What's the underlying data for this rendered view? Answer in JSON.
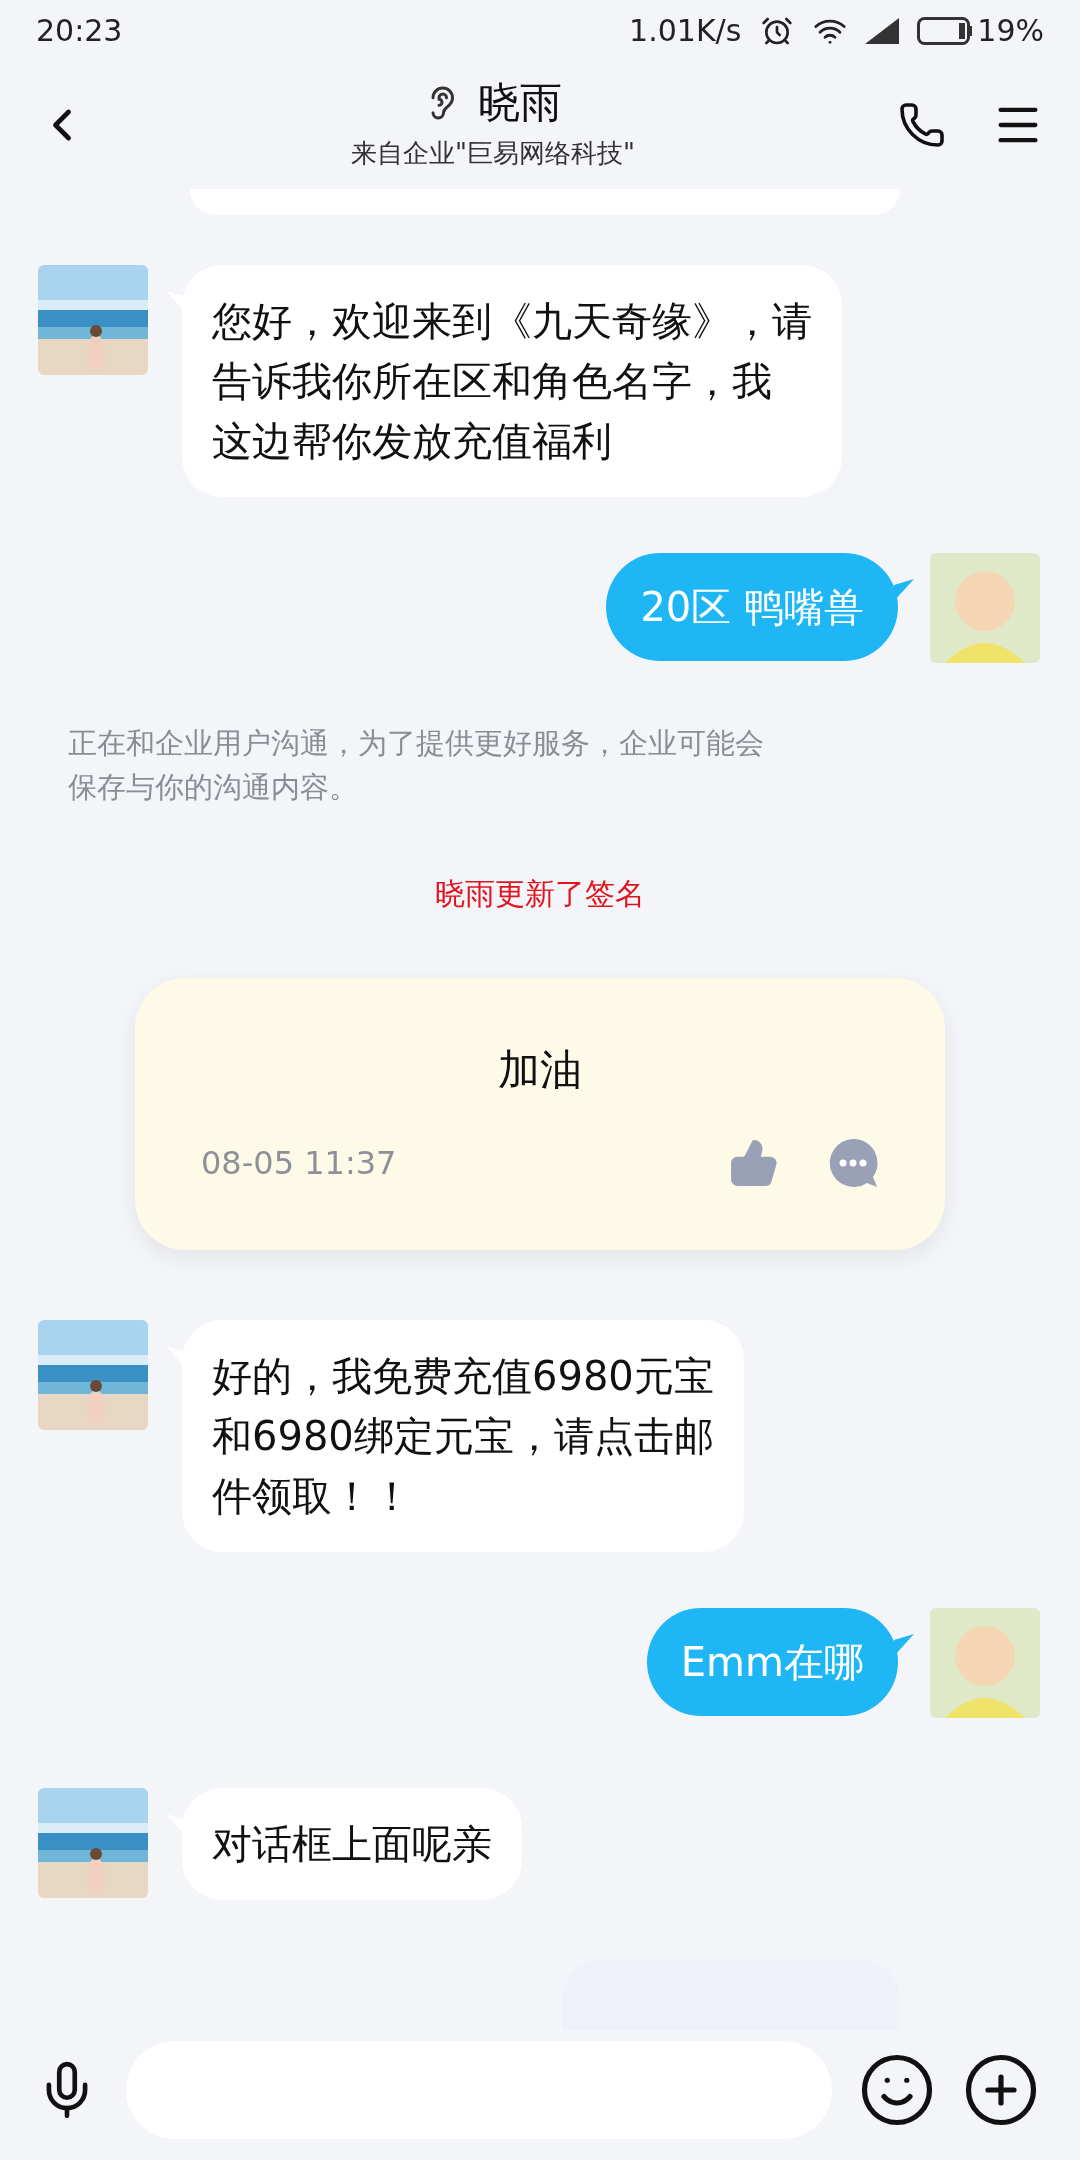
{
  "status_bar": {
    "time": "20:23",
    "network_speed": "1.01K/s",
    "battery": "19%"
  },
  "header": {
    "title": "晓雨",
    "subtitle": "来自企业\"巨易网络科技\""
  },
  "messages": [
    {
      "kind": "partial_incoming"
    },
    {
      "kind": "incoming",
      "lines": [
        "您好，欢迎来到《九天奇缘》，请",
        "告诉我你所在区和角色名字，我",
        "这边帮你发放充值福利"
      ]
    },
    {
      "kind": "outgoing",
      "lines": [
        "20区 鸭嘴兽"
      ]
    },
    {
      "kind": "notice",
      "lines": [
        "正在和企业用户沟通，为了提供更好服务，企业可能会",
        "保存与你的沟通内容。"
      ]
    },
    {
      "kind": "system",
      "text": "晓雨更新了签名"
    },
    {
      "kind": "signature_card",
      "text": "加油",
      "time": "08-05 11:37"
    },
    {
      "kind": "incoming",
      "lines": [
        "好的，我免费充值6980元宝",
        "和6980绑定元宝，请点击邮",
        "件领取！！"
      ]
    },
    {
      "kind": "outgoing",
      "lines": [
        "Emm在哪"
      ]
    },
    {
      "kind": "incoming",
      "lines": [
        "对话框上面呢亲"
      ]
    },
    {
      "kind": "partial_outgoing"
    }
  ]
}
